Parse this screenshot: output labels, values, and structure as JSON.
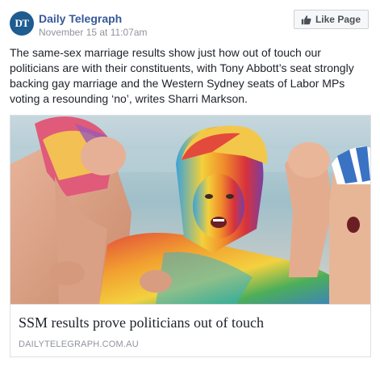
{
  "post": {
    "page": {
      "avatar_text": "DT",
      "name": "Daily Telegraph",
      "timestamp": "November 15 at 11:07am"
    },
    "like_button": {
      "icon": "thumbs-up-icon",
      "label": "Like Page"
    },
    "text": "The same-sex marriage results show just how out of touch our politicians are with their constituents, with Tony Abbott’s seat strongly backing gay marriage and the Western Sydney seats of Labor MPs voting a resounding ‘no’, writes Sharri Markson.",
    "link": {
      "title": "SSM results prove politicians out of touch",
      "domain": "DAILYTELEGRAPH.COM.AU"
    }
  },
  "colors": {
    "page_name": "#365899",
    "text": "#1d2129",
    "meta": "#90949c",
    "avatar": "#1f5c8f",
    "border": "#dddfe2"
  }
}
